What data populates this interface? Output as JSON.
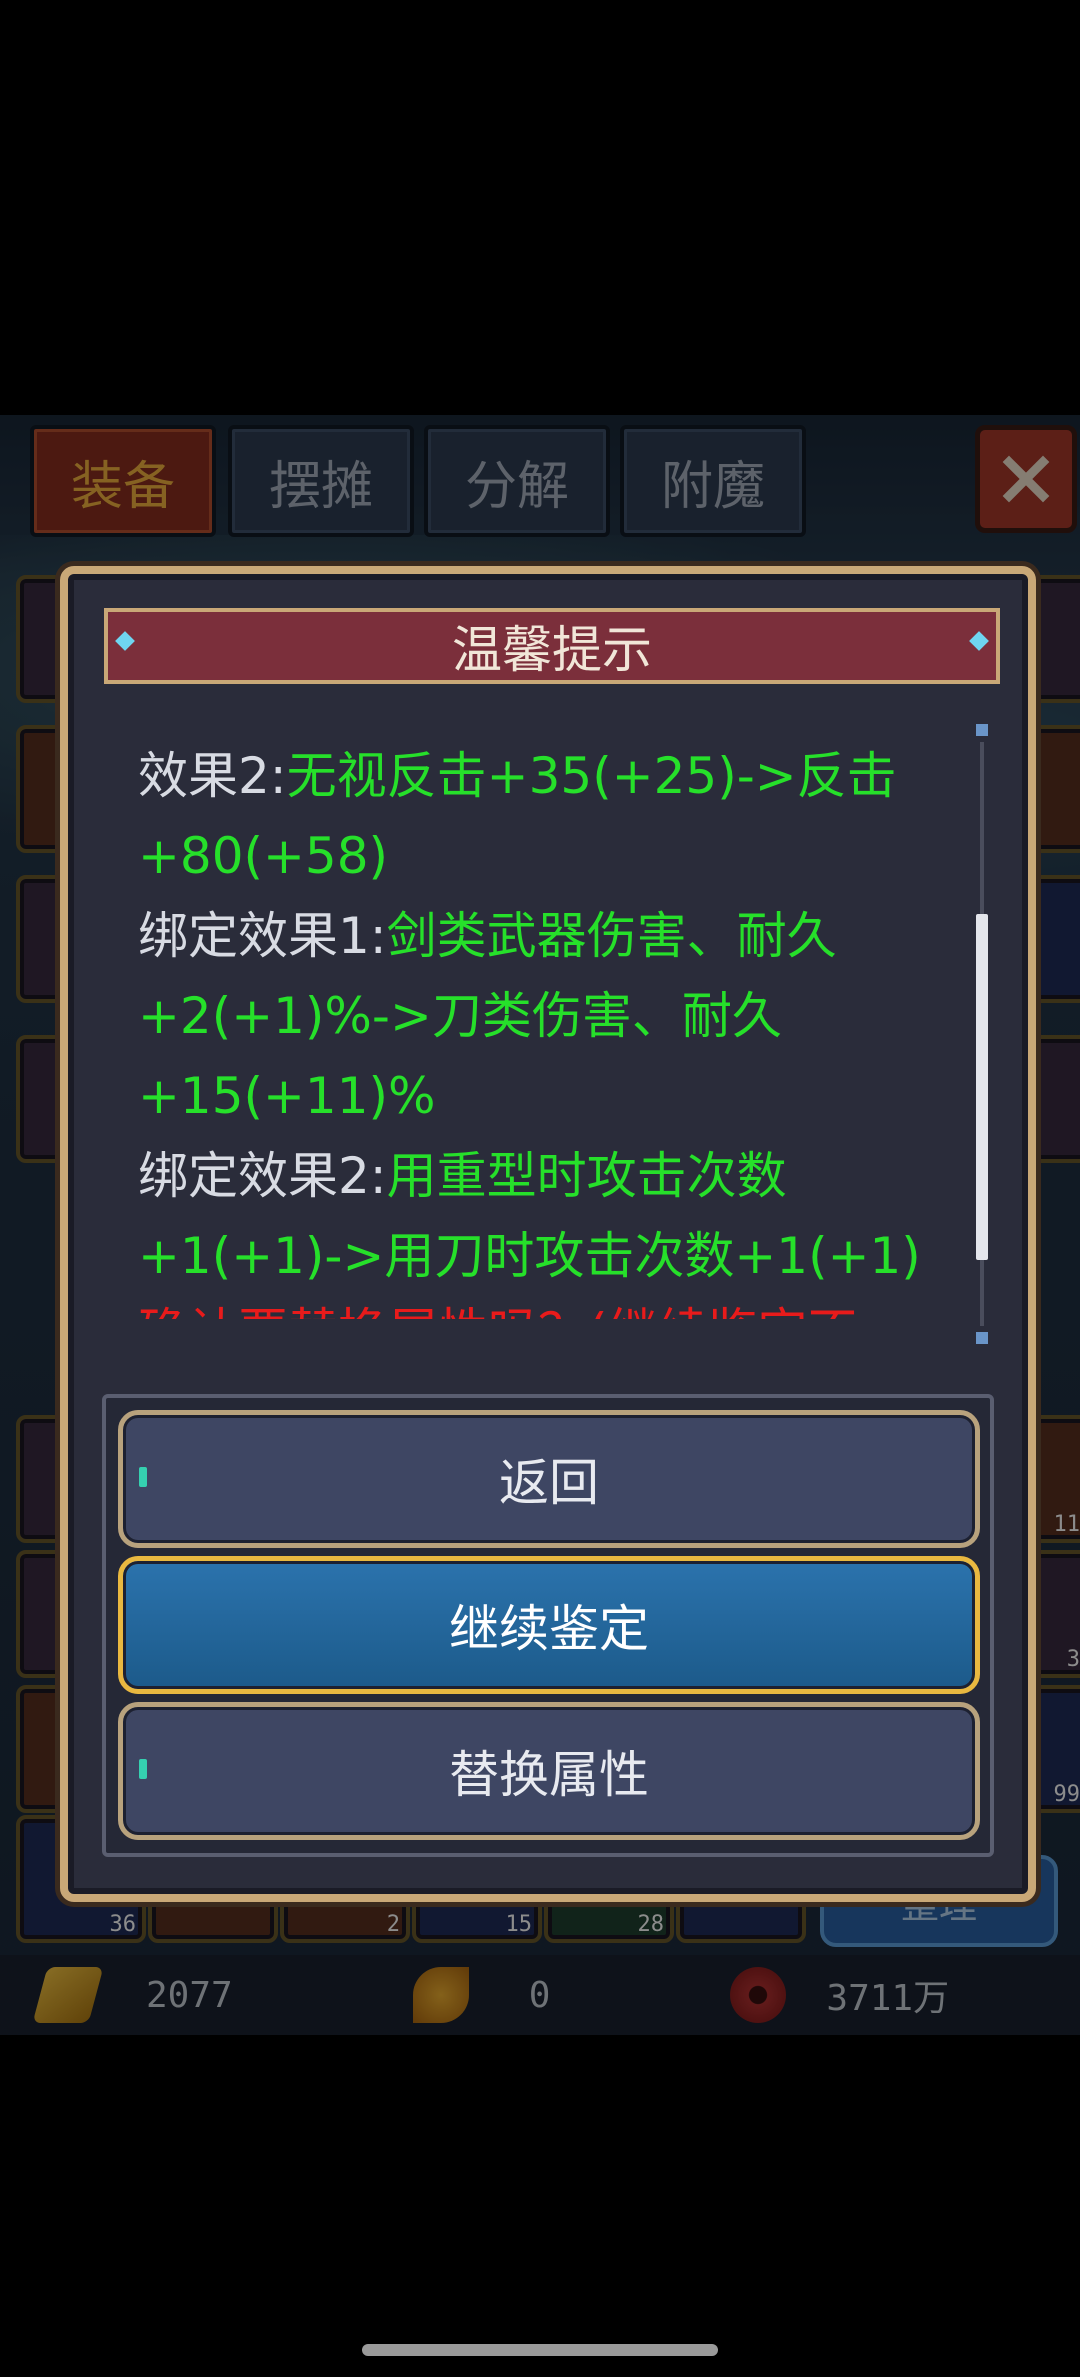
{
  "tabs": [
    {
      "label": "装备",
      "active": true
    },
    {
      "label": "摆摊",
      "active": false
    },
    {
      "label": "分解",
      "active": false
    },
    {
      "label": "附魔",
      "active": false
    }
  ],
  "inventory": {
    "counts": [
      "11",
      "3",
      "99",
      "36",
      "2",
      "15",
      "28"
    ],
    "sort_label": "整理"
  },
  "currency": {
    "gold": "2077",
    "leaf": "0",
    "coins": "3711万"
  },
  "dialog": {
    "title": "温馨提示",
    "lines": [
      {
        "label": "效果2:",
        "value": "无视反击+35(+25)->反击"
      },
      {
        "value": "+80(+58)"
      },
      {
        "label": "绑定效果1:",
        "value": "剑类武器伤害、耐久"
      },
      {
        "value": "+2(+1)%->刀类伤害、耐久"
      },
      {
        "value": "+15(+11)%"
      },
      {
        "label": "绑定效果2:",
        "value": "用重型时攻击次数"
      },
      {
        "value": "+1(+1)->用刀时攻击次数+1(+1)"
      }
    ],
    "partial_bottom": "确认要替换属性吗？(继续鉴定不",
    "buttons": {
      "back": "返回",
      "continue": "继续鉴定",
      "replace": "替换属性"
    }
  },
  "colors": {
    "effect_value": "#26e02a",
    "warning": "#e81b1b",
    "label": "#d8dbe3"
  }
}
